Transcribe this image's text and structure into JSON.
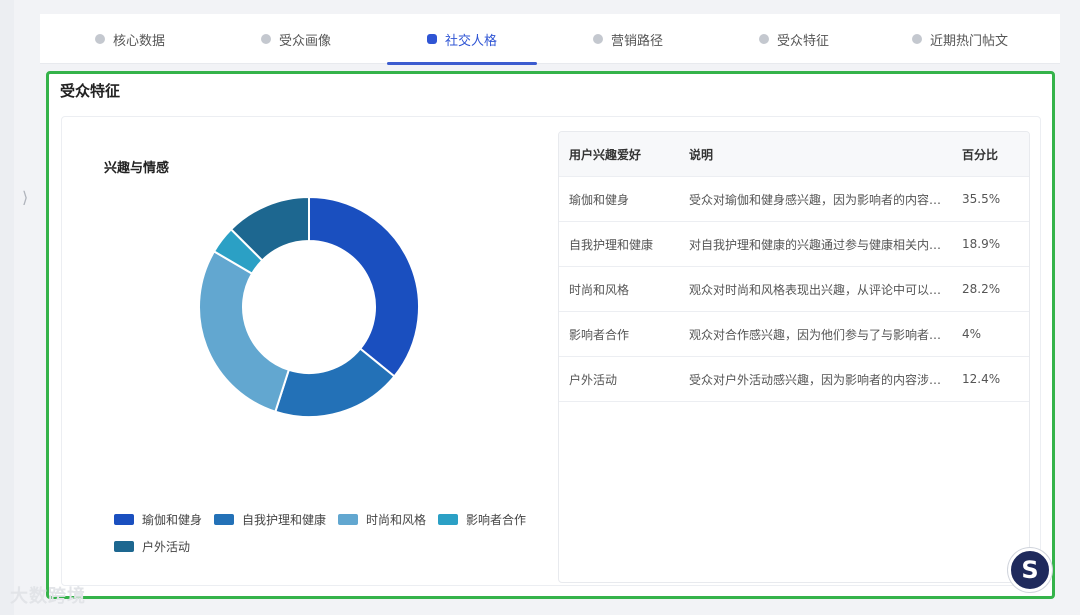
{
  "tabs": [
    {
      "label": "核心数据",
      "icon": "pie-icon",
      "active": false
    },
    {
      "label": "受众画像",
      "icon": "user-icon",
      "active": false
    },
    {
      "label": "社交人格",
      "icon": "chat-icon",
      "active": true
    },
    {
      "label": "营销路径",
      "icon": "person-icon",
      "active": false
    },
    {
      "label": "受众特征",
      "icon": "check-icon",
      "active": false
    },
    {
      "label": "近期热门帖文",
      "icon": "post-icon",
      "active": false
    }
  ],
  "section": {
    "title": "受众特征"
  },
  "chart_title": "兴趣与情感",
  "table": {
    "headers": {
      "interest": "用户兴趣爱好",
      "desc": "说明",
      "percent": "百分比"
    },
    "rows": [
      {
        "interest": "瑜伽和健身",
        "desc": "受众对瑜伽和健身感兴趣，因为影响者的内容围…",
        "percent": "35.5%"
      },
      {
        "interest": "自我护理和健康",
        "desc": "对自我护理和健康的兴趣通过参与健康相关内容…",
        "percent": "18.9%"
      },
      {
        "interest": "时尚和风格",
        "desc": "观众对时尚和风格表现出兴趣，从评论中可以看…",
        "percent": "28.2%"
      },
      {
        "interest": "影响者合作",
        "desc": "观众对合作感兴趣，因为他们参与了与影响者合…",
        "percent": "4%"
      },
      {
        "interest": "户外活动",
        "desc": "受众对户外活动感兴趣，因为影响者的内容涉及…",
        "percent": "12.4%"
      }
    ]
  },
  "chart_data": {
    "type": "pie",
    "categories": [
      "瑜伽和健身",
      "自我护理和健康",
      "时尚和风格",
      "影响者合作",
      "户外活动"
    ],
    "values": [
      35.5,
      18.9,
      28.2,
      4,
      12.4
    ],
    "colors": [
      "#1a4fbf",
      "#2371b7",
      "#62a7d0",
      "#2ba0c5",
      "#1d6790"
    ],
    "title": "兴趣与情感",
    "legend_position": "bottom"
  },
  "brand_badge": "S",
  "watermark": "大数跨境"
}
